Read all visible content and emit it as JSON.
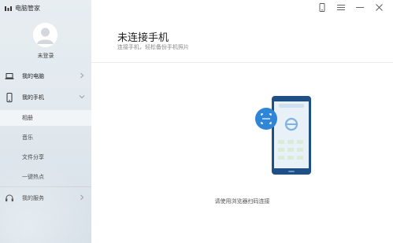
{
  "app": {
    "title": "电脑管家",
    "logo_icon": "app-logo-icon"
  },
  "window_controls": [
    {
      "name": "phone-mode-icon"
    },
    {
      "name": "menu-icon"
    },
    {
      "name": "minimize-icon"
    },
    {
      "name": "close-icon"
    }
  ],
  "user": {
    "status": "未登录",
    "avatar_icon": "avatar-icon"
  },
  "sidebar": {
    "my_pc": {
      "label": "我的电脑",
      "icon": "laptop-icon",
      "arrow": "chevron-right-icon"
    },
    "my_phone": {
      "label": "我的手机",
      "icon": "phone-icon",
      "arrow": "chevron-down-icon"
    },
    "sub_items": [
      {
        "label": "相册",
        "active": true
      },
      {
        "label": "音乐",
        "active": false
      },
      {
        "label": "文件分享",
        "active": false
      },
      {
        "label": "一键热点",
        "active": false
      }
    ],
    "my_service": {
      "label": "我的服务",
      "icon": "headset-icon",
      "arrow": "chevron-right-icon"
    }
  },
  "main": {
    "title": "未连接手机",
    "subtitle": "连接手机，轻松备份手机照片",
    "hint": "请使用浏览器扫码连接",
    "illustration_icon": "phone-scan-illustration"
  },
  "colors": {
    "accent": "#2f86d6",
    "phone_frame": "#1f4f87",
    "sidebar_bg": "#e4ebf0",
    "active_row": "#f2f5f8"
  }
}
